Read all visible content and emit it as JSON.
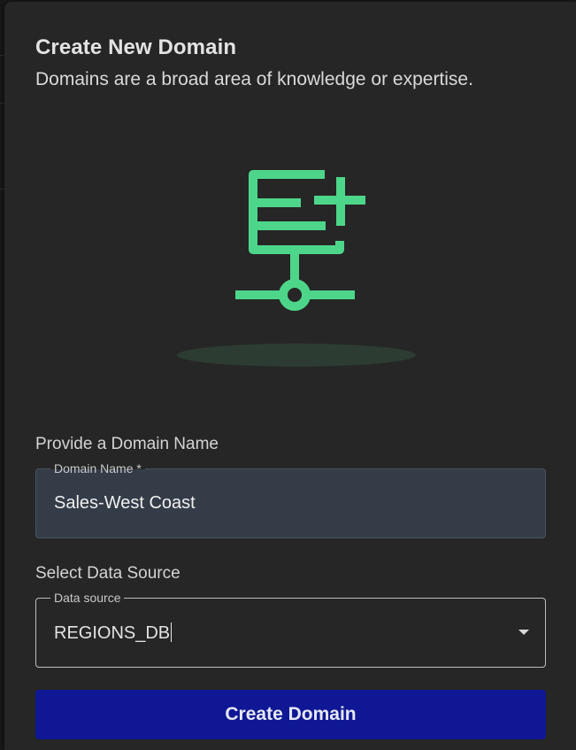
{
  "dialog": {
    "title": "Create New Domain",
    "subtitle": "Domains are a broad area of knowledge or expertise."
  },
  "illustration": {
    "icon": "domain-add-icon",
    "accent_color": "#4dd68a"
  },
  "domain_name_section": {
    "label": "Provide a Domain Name",
    "field_label": "Domain Name *",
    "value": "Sales-West Coast"
  },
  "data_source_section": {
    "label": "Select Data Source",
    "field_label": "Data source",
    "value": "REGIONS_DB",
    "dropdown_icon": "caret-down-icon"
  },
  "actions": {
    "create_label": "Create Domain",
    "create_color": "#0f1794"
  }
}
